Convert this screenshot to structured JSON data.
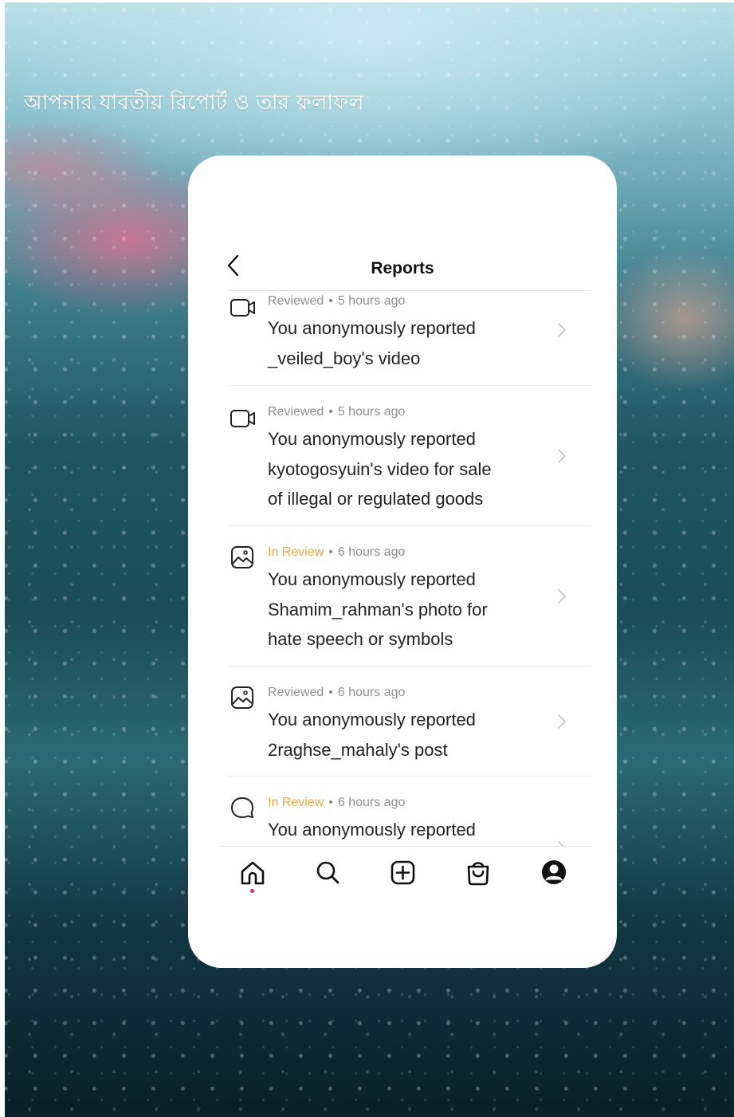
{
  "headline": "আপনার যাবতীয় রিপোর্ট ও তার ফলাফল",
  "screen": {
    "title": "Reports",
    "items": [
      {
        "type_icon": "video-icon",
        "status": "Reviewed",
        "status_kind": "reviewed",
        "time": "5 hours ago",
        "lines": [
          "You anonymously reported",
          "_veiled_boy's video"
        ]
      },
      {
        "type_icon": "video-icon",
        "status": "Reviewed",
        "status_kind": "reviewed",
        "time": "5 hours ago",
        "lines": [
          "You anonymously reported",
          "kyotogosyuin's video for sale",
          "of illegal or regulated goods"
        ]
      },
      {
        "type_icon": "photo-icon",
        "status": "In Review",
        "status_kind": "in-review",
        "time": "6 hours ago",
        "lines": [
          "You anonymously reported",
          "Shamim_rahman's photo for",
          "hate speech or symbols"
        ]
      },
      {
        "type_icon": "photo-icon",
        "status": "Reviewed",
        "status_kind": "reviewed",
        "time": "6 hours ago",
        "lines": [
          "You anonymously reported",
          "2raghse_mahaly's post"
        ]
      },
      {
        "type_icon": "comment-icon",
        "status": "In Review",
        "status_kind": "in-review",
        "time": "6 hours ago",
        "lines": [
          "You anonymously reported"
        ]
      }
    ],
    "bottom_nav": [
      "home-icon",
      "search-icon",
      "create-post-icon",
      "shop-icon",
      "profile-icon"
    ]
  },
  "colors": {
    "in_review": "#f0a545",
    "meta_gray": "#8e8e8e",
    "notification_dot": "#e0245e"
  }
}
